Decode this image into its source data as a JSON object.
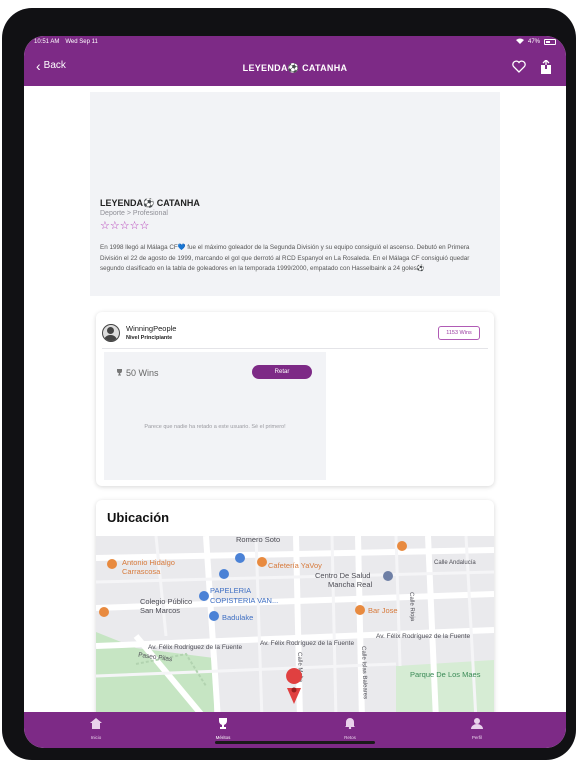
{
  "status_bar": {
    "time": "10:51 AM",
    "date": "Wed Sep 11",
    "battery": "47%"
  },
  "nav": {
    "back_label": "Back",
    "title": "LEYENDA⚽ CATANHA"
  },
  "hero": {
    "title": "LEYENDA⚽ CATANHA",
    "category": "Deporte > Profesional",
    "rating": 0,
    "stars": "☆☆☆☆☆",
    "description": "En 1998 llegó al Málaga CF💙 fue el máximo goleador de la Segunda División y su equipo consiguió el ascenso. Debutó en Primera División el 22 de agosto de 1999, marcando el gol que derrotó al RCD Espanyol en La Rosaleda. En el Málaga CF consiguió quedar segundo clasificado en la tabla de goleadores en la temporada 1999/2000, empatado con Hasselbaink a 24 goles⚽"
  },
  "user": {
    "name": "WinningPeople",
    "level": "Nivel Principiante",
    "wins": "1153 Wins"
  },
  "challenge": {
    "amount": "50 Wins",
    "button_label": "Retar",
    "empty_message": "Parece que nadie ha retado a este usuario. Sé el primero!"
  },
  "location": {
    "title": "Ubicación",
    "map_labels": {
      "romero_soto": "Romero Soto",
      "antonio_1": "Antonio Hidalgo",
      "antonio_2": "Carrascosa",
      "cafeteria": "Cafetería YaVoy",
      "centro_1": "Centro De Salud",
      "centro_2": "Mancha Real",
      "papeleria_1": "PAPELERIA",
      "papeleria_2": "COPISTERIA VAN...",
      "colegio_1": "Colegio Público",
      "colegio_2": "San Marcos",
      "badulake": "Badulake",
      "bar_jose": "Bar Jose",
      "calle_andalucia": "Calle Andalucía",
      "calle_rioja": "Calle Rioja",
      "av_felix_1": "Av. Félix Rodríguez de la Fuente",
      "av_felix_2": "Av. Félix Rodríguez de la Fuente",
      "av_felix_3": "Av. Félix Rodríguez de la Fuente",
      "paseo_pilas": "Paseo Pilas",
      "calle_malta": "Calle Malta",
      "calle_islas": "Calle Islas Baleares",
      "parque": "Parque De Los Maes"
    }
  },
  "tabs": [
    {
      "label": "Inicio",
      "icon": "home-icon"
    },
    {
      "label": "Méritos",
      "icon": "trophy-icon"
    },
    {
      "label": "Retos",
      "icon": "bell-icon"
    },
    {
      "label": "Perfil",
      "icon": "person-icon"
    }
  ],
  "colors": {
    "primary": "#7d2a86",
    "accent": "#b236b8",
    "background": "#ffffff",
    "hero_bg": "#f2f3f6"
  }
}
